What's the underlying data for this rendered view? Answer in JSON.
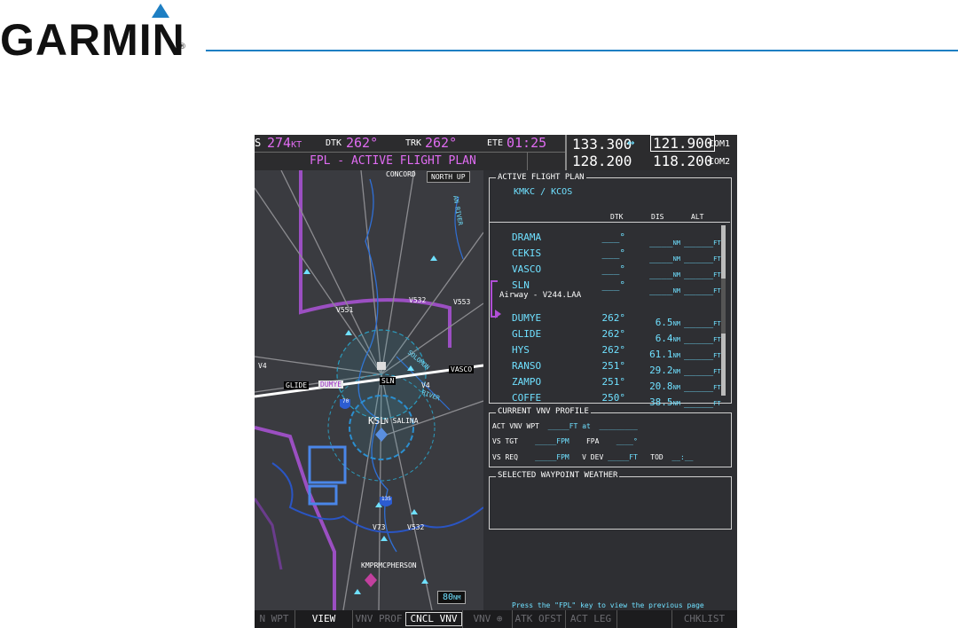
{
  "brand": {
    "name": "GARMIN",
    "reg_mark": "®",
    "accent": "#1e7fc3"
  },
  "top_bar": {
    "gs_label": "S",
    "gs_value": "274",
    "gs_unit": "KT",
    "dtk_label": "DTK",
    "dtk_value": "262°",
    "trk_label": "TRK",
    "trk_value": "262°",
    "ete_label": "ETE",
    "ete_value": "01:25",
    "page_title": "FPL - ACTIVE FLIGHT PLAN"
  },
  "com": {
    "com1_standby": "133.300",
    "swap_icon": "↔",
    "com1_active": "121.900",
    "com1_label": "COM1",
    "com2_standby": "128.200",
    "com2_active": "118.200",
    "com2_label": "COM2"
  },
  "map": {
    "orientation": "NORTH UP",
    "range": "80",
    "range_unit": "NM",
    "labels": {
      "concord": "CONCORD",
      "v551": "V551",
      "v532": "V532",
      "v553": "V553",
      "v4_left": "V4",
      "vasco": "VASCO",
      "v4": "V4",
      "slin": "SLN",
      "glide": "GLIDE",
      "dumye": "DUMYE",
      "ksl": "KSL",
      "salina": "N SALINA",
      "route_70": "70",
      "route_135": "135",
      "v73": "V73",
      "v532b": "V532",
      "kmpr": "KMPRMCPHERSON",
      "solomon": "SOLOMON",
      "river": "RIVER",
      "an_river": "AN RIVER"
    }
  },
  "flight_plan": {
    "box_label": "ACTIVE FLIGHT PLAN",
    "route": "KMKC / KCOS",
    "headers": {
      "dtk": "DTK",
      "dis": "DIS",
      "alt": "ALT"
    },
    "airway_label": "Airway - V244.LAA",
    "waypoints": [
      {
        "name": "DRAMA",
        "dtk": "___°",
        "dis": "____",
        "dis_unit": "NM",
        "alt": "_____",
        "alt_unit": "FT"
      },
      {
        "name": "CEKIS",
        "dtk": "___°",
        "dis": "____",
        "dis_unit": "NM",
        "alt": "_____",
        "alt_unit": "FT"
      },
      {
        "name": "VASCO",
        "dtk": "___°",
        "dis": "____",
        "dis_unit": "NM",
        "alt": "_____",
        "alt_unit": "FT"
      },
      {
        "name": "SLN",
        "dtk": "___°",
        "dis": "____",
        "dis_unit": "NM",
        "alt": "_____",
        "alt_unit": "FT"
      },
      {
        "name": "DUMYE",
        "dtk": "262°",
        "dis": "6.5",
        "dis_unit": "NM",
        "alt": "_____",
        "alt_unit": "FT"
      },
      {
        "name": "GLIDE",
        "dtk": "262°",
        "dis": "6.4",
        "dis_unit": "NM",
        "alt": "_____",
        "alt_unit": "FT"
      },
      {
        "name": "HYS",
        "dtk": "262°",
        "dis": "61.1",
        "dis_unit": "NM",
        "alt": "_____",
        "alt_unit": "FT"
      },
      {
        "name": "RANSO",
        "dtk": "251°",
        "dis": "29.2",
        "dis_unit": "NM",
        "alt": "_____",
        "alt_unit": "FT"
      },
      {
        "name": "ZAMPO",
        "dtk": "251°",
        "dis": "20.8",
        "dis_unit": "NM",
        "alt": "_____",
        "alt_unit": "FT"
      },
      {
        "name": "COFFE",
        "dtk": "250°",
        "dis": "38.5",
        "dis_unit": "NM",
        "alt": "_____",
        "alt_unit": "FT"
      }
    ]
  },
  "vnv": {
    "box_label": "CURRENT VNV PROFILE",
    "act_wpt_label": "ACT VNV WPT",
    "act_wpt_alt": "_____",
    "act_wpt_unit": "FT",
    "at_label": "at",
    "act_wpt_name": "_________",
    "vs_tgt_label": "VS TGT",
    "vs_tgt": "_____",
    "vs_tgt_unit": "FPM",
    "fpa_label": "FPA",
    "fpa": "____°",
    "vs_req_label": "VS REQ",
    "vs_req": "_____",
    "vs_req_unit": "FPM",
    "vdev_label": "V DEV",
    "vdev": "_____",
    "vdev_unit": "FT",
    "tod_label": "TOD",
    "tod": "__:__"
  },
  "weather": {
    "box_label": "SELECTED WAYPOINT WEATHER"
  },
  "footer_hint": "Press the \"FPL\" key to view the previous page",
  "softkeys": [
    "N WPT",
    "VIEW",
    "VNV PROF",
    "CNCL VNV",
    "VNV ⊕",
    "ATK OFST",
    "ACT LEG",
    "",
    "CHKLIST"
  ]
}
